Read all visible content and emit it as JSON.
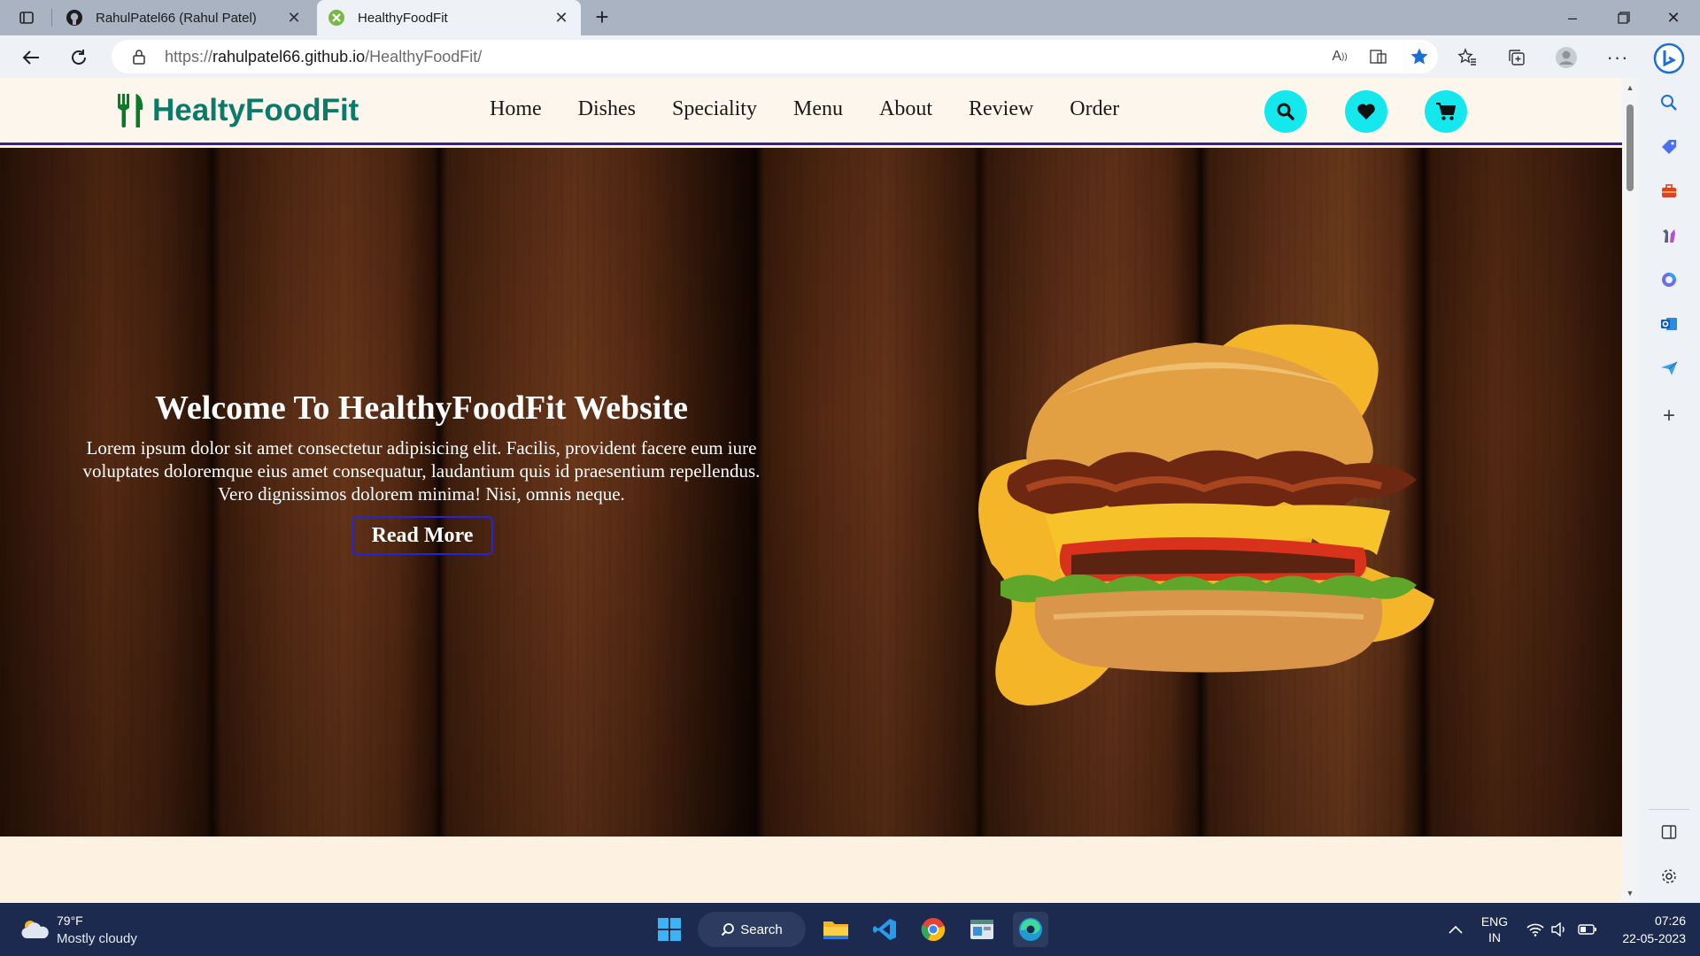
{
  "browser": {
    "tabs": [
      {
        "title": "RahulPatel66 (Rahul Patel)",
        "favicon": "github-icon",
        "active": false
      },
      {
        "title": "HealthyFoodFit",
        "favicon": "site-favicon",
        "active": true
      }
    ],
    "url_scheme": "https://",
    "url_host": "rahulpatel66.github.io",
    "url_path": "/HealthyFoodFit/"
  },
  "site": {
    "logo_text": "HealtyFoodFit",
    "nav": [
      "Home",
      "Dishes",
      "Speciality",
      "Menu",
      "About",
      "Review",
      "Order"
    ],
    "header_icons": [
      "search-icon",
      "heart-icon",
      "cart-icon"
    ],
    "accent_color": "#14e8ec",
    "brand_color": "#0a7a6a"
  },
  "hero": {
    "title": "Welcome To HealthyFoodFit Website",
    "text": "Lorem ipsum dolor sit amet consectetur adipisicing elit. Facilis, provident facere eum iure voluptates doloremque eius amet consequatur, laudantium quis id praesentium repellendus. Vero dignissimos dolorem minima! Nisi, omnis neque.",
    "button_label": "Read More"
  },
  "taskbar": {
    "weather_temp": "79°F",
    "weather_desc": "Mostly cloudy",
    "search_label": "Search",
    "lang_line1": "ENG",
    "lang_line2": "IN",
    "time": "07:26",
    "date": "22-05-2023"
  }
}
